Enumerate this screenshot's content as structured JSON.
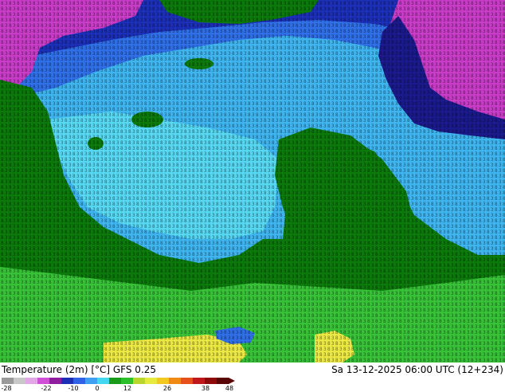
{
  "footer": {
    "title": "Temperature (2m) [°C] GFS 0.25",
    "datetime": "Sa 13-12-2025 06:00 UTC (12+234)"
  },
  "colorbar": {
    "ticks": [
      "-28",
      "-22",
      "-10",
      "0",
      "12",
      "26",
      "38",
      "48"
    ],
    "colors": [
      "#9a9a9a",
      "#c8c8c8",
      "#e2a6e6",
      "#cf4fd7",
      "#8e1e9e",
      "#1b2fb5",
      "#2f62e6",
      "#3fa0f2",
      "#43d7f0",
      "#1a9a1a",
      "#2cbf2c",
      "#b8d62c",
      "#e6ea3c",
      "#f2c820",
      "#f08a14",
      "#e6501a",
      "#c0181a",
      "#8c0a0a",
      "#5a0505"
    ]
  },
  "map": {
    "colors": {
      "green": "#0b7a0b",
      "light_cyan": "#57d8f2",
      "cyan": "#3fb5f0",
      "blue": "#2f6fe8",
      "dark_blue": "#1c2fb8",
      "navy": "#1a1a8c",
      "magenta": "#c83cc8",
      "light_green": "#38c238",
      "yellow": "#ebe844"
    }
  }
}
